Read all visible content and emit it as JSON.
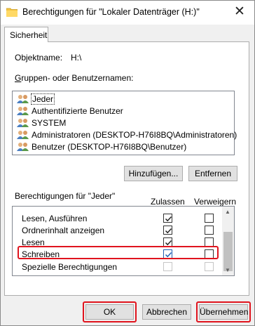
{
  "window": {
    "title": "Berechtigungen für \"Lokaler Datenträger (H:)\"",
    "close_glyph": "✕"
  },
  "tab": {
    "label": "Sicherheit"
  },
  "object": {
    "label": "Objektname:",
    "value": "H:\\"
  },
  "groups": {
    "label_prefix": "",
    "label": "Gruppen- oder Benutzernamen:",
    "items": [
      {
        "name": "Jeder",
        "icon": "users-icon"
      },
      {
        "name": "Authentifizierte Benutzer",
        "icon": "users-icon"
      },
      {
        "name": "SYSTEM",
        "icon": "users-icon"
      },
      {
        "name": "Administratoren (DESKTOP-H76I8BQ\\Administratoren)",
        "icon": "users-icon"
      },
      {
        "name": "Benutzer (DESKTOP-H76I8BQ\\Benutzer)",
        "icon": "users-icon"
      }
    ],
    "selected_index": 0
  },
  "buttons": {
    "add": "Hinzufügen...",
    "remove": "Entfernen",
    "ok": "OK",
    "cancel": "Abbrechen",
    "apply": "Übernehmen"
  },
  "permissions": {
    "label": "Berechtigungen für \"Jeder\"",
    "col_allow": "Zulassen",
    "col_deny": "Verweigern",
    "rows": [
      {
        "name": "Lesen, Ausführen",
        "allow": true,
        "deny": false,
        "disabled": false
      },
      {
        "name": "Ordnerinhalt anzeigen",
        "allow": true,
        "deny": false,
        "disabled": false
      },
      {
        "name": "Lesen",
        "allow": true,
        "deny": false,
        "disabled": false
      },
      {
        "name": "Schreiben",
        "allow": true,
        "deny": false,
        "disabled": false,
        "highlighted": true
      },
      {
        "name": "Spezielle Berechtigungen",
        "allow": false,
        "deny": false,
        "disabled": true
      }
    ]
  },
  "colors": {
    "highlight": "#e0141e",
    "button_face": "#e1e1e1",
    "check_blue": "#1f5fb4"
  }
}
